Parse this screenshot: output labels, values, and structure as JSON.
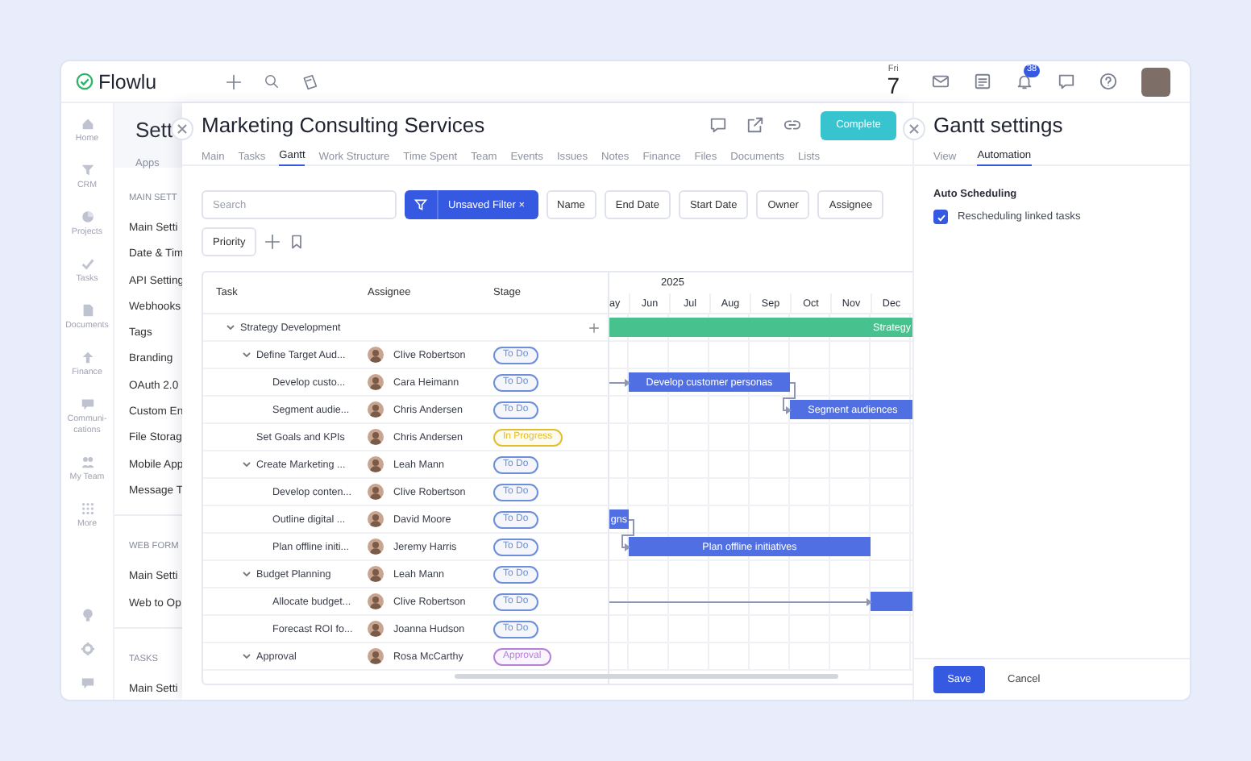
{
  "topbar": {
    "logo": "Flowlu",
    "date": {
      "weekday": "Fri",
      "day": "7"
    },
    "notification_badge": "38"
  },
  "nav": [
    "Home",
    "CRM",
    "Projects",
    "Tasks",
    "Documents",
    "Finance",
    "Communi-cations",
    "My Team",
    "More"
  ],
  "settings": {
    "title": "Sett",
    "tab": "Apps",
    "sections": [
      {
        "heading": "MAIN SETT",
        "items": [
          "Main Setti",
          "Date & Tim",
          "API Setting",
          "Webhooks",
          "Tags",
          "Branding",
          "OAuth 2.0",
          "Custom En",
          "File Storag",
          "Mobile App",
          "Message T"
        ]
      },
      {
        "heading": "WEB FORM",
        "items": [
          "Main Setti",
          "Web to Op"
        ]
      },
      {
        "heading": "TASKS",
        "items": [
          "Main Setti"
        ]
      }
    ]
  },
  "project": {
    "title": "Marketing Consulting Services",
    "complete_button": "Complete",
    "tabs": [
      {
        "label": "Main",
        "selected": false
      },
      {
        "label": "Tasks",
        "selected": false
      },
      {
        "label": "Gantt",
        "selected": true
      },
      {
        "label": "Work Structure",
        "selected": false
      },
      {
        "label": "Time Spent",
        "selected": false
      },
      {
        "label": "Team",
        "selected": false
      },
      {
        "label": "Events",
        "selected": false
      },
      {
        "label": "Issues",
        "selected": false
      },
      {
        "label": "Notes",
        "selected": false
      },
      {
        "label": "Finance",
        "selected": false
      },
      {
        "label": "Files",
        "selected": false
      },
      {
        "label": "Documents",
        "selected": false
      },
      {
        "label": "Lists",
        "selected": false
      }
    ],
    "search": {
      "placeholder": "Search"
    },
    "filter": {
      "label": "Unsaved Filter",
      "clear": "×"
    },
    "filter_fields": [
      "Name",
      "End Date",
      "Start Date",
      "Owner",
      "Assignee",
      "Priority"
    ],
    "table": {
      "columns": [
        "Task",
        "Assignee",
        "Stage"
      ],
      "rows": [
        {
          "task": "Strategy Development",
          "expanded": true,
          "add_button": true,
          "bar": {
            "label": "Strategy",
            "color": "#47c28f",
            "months": [
              true,
              true,
              true,
              true,
              true,
              true,
              true,
              true
            ]
          },
          "children": [
            {
              "task": "Define Target Aud...",
              "expanded": true,
              "assignee": "Clive Robertson",
              "stage": {
                "label": "To Do",
                "color": "#6d8fd9"
              },
              "children": [
                {
                  "task": "Develop custo...",
                  "assignee": "Cara Heimann",
                  "stage": {
                    "label": "To Do",
                    "color": "#6d8fd9"
                  },
                  "bar": {
                    "label": "Develop customer personas",
                    "color": "#4f6fe3",
                    "linked": true,
                    "months": [
                      false,
                      true,
                      true,
                      true,
                      true,
                      false,
                      false,
                      false
                    ]
                  }
                },
                {
                  "task": "Segment audie...",
                  "assignee": "Chris Andersen",
                  "stage": {
                    "label": "To Do",
                    "color": "#6d8fd9"
                  },
                  "bar": {
                    "label": "Segment audiences",
                    "color": "#4f6fe3",
                    "linked": true,
                    "months": [
                      false,
                      false,
                      false,
                      false,
                      false,
                      true,
                      true,
                      true
                    ]
                  }
                }
              ]
            },
            {
              "task": "Set Goals and KPIs",
              "assignee": "Chris Andersen",
              "stage": {
                "label": "In Progress",
                "color": "#e2bf2e"
              }
            },
            {
              "task": "Create Marketing ...",
              "expanded": true,
              "assignee": "Leah Mann",
              "stage": {
                "label": "To Do",
                "color": "#6d8fd9"
              },
              "children": [
                {
                  "task": "Develop conten...",
                  "assignee": "Clive Robertson",
                  "stage": {
                    "label": "To Do",
                    "color": "#6d8fd9"
                  }
                },
                {
                  "task": "Outline digital ...",
                  "assignee": "David Moore",
                  "stage": {
                    "label": "To Do",
                    "color": "#6d8fd9"
                  },
                  "bar": {
                    "label": "gns",
                    "color": "#4f6fe3",
                    "months": [
                      true,
                      false,
                      false,
                      false,
                      false,
                      false,
                      false,
                      false
                    ]
                  }
                },
                {
                  "task": "Plan offline initi...",
                  "assignee": "Jeremy Harris",
                  "stage": {
                    "label": "To Do",
                    "color": "#6d8fd9"
                  },
                  "bar": {
                    "label": "Plan offline initiatives",
                    "color": "#4f6fe3",
                    "linked": true,
                    "months": [
                      false,
                      true,
                      true,
                      true,
                      true,
                      true,
                      true,
                      false
                    ]
                  }
                }
              ]
            },
            {
              "task": "Budget Planning",
              "expanded": true,
              "assignee": "Leah Mann",
              "stage": {
                "label": "To Do",
                "color": "#6d8fd9"
              },
              "children": [
                {
                  "task": "Allocate budget...",
                  "assignee": "Clive Robertson",
                  "stage": {
                    "label": "To Do",
                    "color": "#6d8fd9"
                  },
                  "bar": {
                    "color": "#4f6fe3",
                    "linked": true,
                    "months": [
                      false,
                      false,
                      false,
                      false,
                      false,
                      false,
                      false,
                      true
                    ]
                  }
                },
                {
                  "task": "Forecast ROI fo...",
                  "assignee": "Joanna Hudson",
                  "stage": {
                    "label": "To Do",
                    "color": "#6d8fd9"
                  }
                }
              ]
            },
            {
              "task": "Approval",
              "expanded": true,
              "assignee": "Rosa McCarthy",
              "stage": {
                "label": "Approval",
                "color": "#b77fdc"
              }
            }
          ]
        }
      ]
    },
    "timeline": {
      "year": "2025",
      "months": [
        "ay",
        "Jun",
        "Jul",
        "Aug",
        "Sep",
        "Oct",
        "Nov",
        "Dec"
      ]
    }
  },
  "gantt_settings": {
    "title": "Gantt settings",
    "tabs": [
      {
        "label": "View",
        "selected": false
      },
      {
        "label": "Automation",
        "selected": true
      }
    ],
    "section": "Auto Scheduling",
    "option": {
      "label": "Rescheduling linked tasks",
      "checked": true
    },
    "save_button": "Save",
    "cancel_button": "Cancel"
  }
}
